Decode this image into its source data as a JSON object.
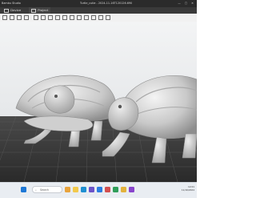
{
  "titlebar": {
    "app": "Bambu Studio",
    "document": "Turtle_cutie - 2024-11-16T120126.690",
    "window_controls": "— ▢ ✕"
  },
  "tabs": [
    {
      "label": "Device",
      "icon": "device-icon"
    },
    {
      "label": "Project",
      "icon": "project-icon"
    }
  ],
  "toolbar_icons": [
    "add-icon",
    "grid-icon",
    "cube-icon",
    "layers-icon",
    "arrange-icon",
    "orient-icon",
    "move-icon",
    "rotate-icon",
    "scale-icon",
    "cut-icon",
    "support-icon",
    "seam-icon",
    "text-icon",
    "measure-icon",
    "assembly-icon"
  ],
  "taskbar": {
    "search_placeholder": "Search",
    "pinned": [
      "start-icon",
      "search-icon",
      "widgets-icon",
      "file-explorer-icon",
      "browser-icon",
      "store-icon",
      "mail-icon",
      "photos-icon",
      "slicer-icon",
      "chrome-icon",
      "media-icon"
    ],
    "pinned_colors": [
      "#1e78d6",
      "#555555",
      "#e8a33c",
      "#f2c94c",
      "#1f8fd1",
      "#6b53c9",
      "#2a7de1",
      "#d34f4f",
      "#2f9e5a",
      "#e3b23c",
      "#8844cc"
    ],
    "tray_time": "12:01",
    "tray_date": "11/16/2024"
  }
}
